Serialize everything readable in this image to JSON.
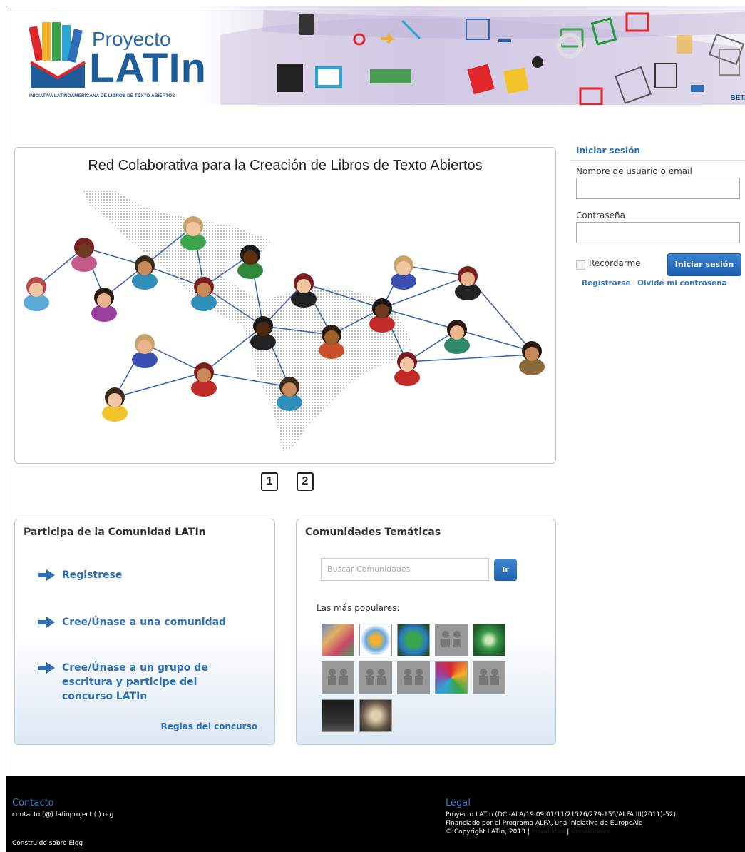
{
  "banner": {
    "logo_small": "Proyecto",
    "logo_big": "LATIn",
    "tagline": "INICIATIVA LATINOAMERICANA DE LIBROS DE TEXTO ABIERTOS",
    "beta": "BETA"
  },
  "slider": {
    "title": "Red Colaborativa para la Creación de Libros de Texto Abiertos",
    "pages": [
      "1",
      "2"
    ]
  },
  "login": {
    "heading": "Iniciar sesión",
    "username_label": "Nombre de usuario o email",
    "password_label": "Contraseña",
    "remember_label": "Recordarme",
    "submit_label": "Iniciar sesión",
    "register_link": "Registrarse",
    "forgot_link": "Olvidé mi contraseña"
  },
  "participate": {
    "heading": "Participa de la Comunidad LATIn",
    "items": [
      "Registrese",
      "Cree/Únase a una comunidad",
      "Cree/Únase a un grupo de escritura y participe del concurso LATIn"
    ],
    "rules_link": "Reglas del concurso"
  },
  "communities": {
    "heading": "Comunidades Temáticas",
    "search_placeholder": "Buscar Comunidades",
    "search_button": "Ir",
    "popular_label": "Las más populares:"
  },
  "footer": {
    "contact_title": "Contacto",
    "contact_email": "contacto (@) latinproject (.) org",
    "built_on": "Construido sobre Elgg",
    "legal_title": "Legal",
    "legal_line1": "Proyecto LATIn (DCI-ALA/19.09.01/11/21526/279-155/ALFA III(2011)-52)",
    "legal_line2": "Financiado por el Programa ALFA, una iniciativa de EuropeAid",
    "legal_line3": "© Copyright LATIn, 2013 |",
    "privacy": "Privacidad",
    "conditions": "Condiciones"
  },
  "colors": {
    "link_blue": "#2e6fb7",
    "button_blue": "#1d5fae",
    "footer_bg": "#000000"
  }
}
